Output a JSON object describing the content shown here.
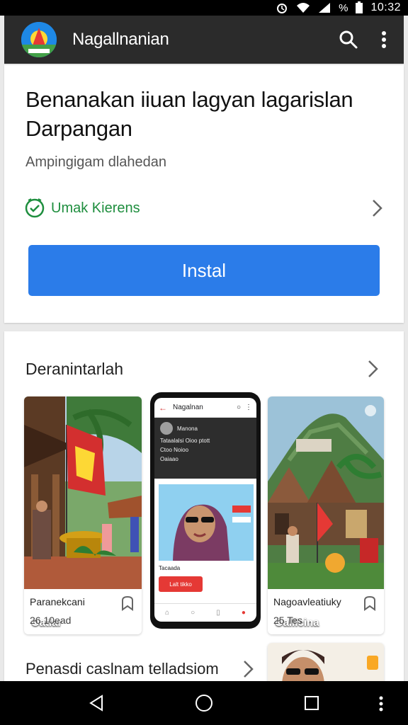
{
  "status_bar": {
    "time": "10:32",
    "battery_text": "%"
  },
  "app_bar": {
    "title": "Nagallnanian"
  },
  "app": {
    "name": "Benanakan iiuan lagyan lagarislan Darpangan",
    "subtitle": "Ampingigam dlahedan",
    "rating_label": "Umak Kierens",
    "install_label": "Instal"
  },
  "gallery": {
    "title": "Deranintarlah",
    "tiles": [
      {
        "caption": "Oatiar",
        "title": "Paranekcani",
        "meta": "26 10ead"
      },
      {
        "caption": "Oallicina",
        "title": "Nagoavleatiuky",
        "meta": "25 Tes"
      }
    ],
    "phone": {
      "header": "Nagalnan",
      "profile_name": "Manona",
      "line1": "Tataalalsi Oioo ptott",
      "line2": "Ctoo Noioo",
      "line3": "Oaiaao",
      "caption": "Tacaada",
      "button": "Lalt tikko"
    }
  },
  "section2": {
    "title": "Penasdi caslnam telladsiom"
  },
  "colors": {
    "accent": "#2b7ce9",
    "rating_green": "#1e8e3e",
    "app_bar": "#2b2b2b"
  }
}
